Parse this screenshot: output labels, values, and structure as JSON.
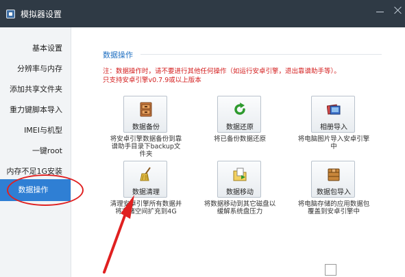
{
  "window": {
    "title": "模拟器设置"
  },
  "sidebar": {
    "items": [
      {
        "label": "基本设置"
      },
      {
        "label": "分辨率与内存"
      },
      {
        "label": "添加共享文件夹"
      },
      {
        "label": "重力键脚本导入"
      },
      {
        "label": "IMEI与机型"
      },
      {
        "label": "一键root"
      },
      {
        "label": "内存不足1G安装"
      },
      {
        "label": "数据操作"
      }
    ],
    "active_index": 7
  },
  "section": {
    "title": "数据操作",
    "notice_line1": "注：数据操作时，请不要进行其他任何操作（如运行安卓引擎，退出靠谱助手等）。",
    "notice_line2": "只支持安卓引擎v0.7.9或以上版本"
  },
  "tiles": [
    {
      "label": "数据备份",
      "desc": "将安卓引擎数据备份到靠谱助手目录下backup文件夹",
      "icon": "cabinet-icon"
    },
    {
      "label": "数据还原",
      "desc": "将已备份数据还原",
      "icon": "refresh-icon"
    },
    {
      "label": "相册导入",
      "desc": "将电脑图片导入安卓引擎中",
      "icon": "photo-album-icon"
    },
    {
      "label": "数据清理",
      "desc": "清理安卓引擎所有数据并将存储空间扩充到4G",
      "icon": "broom-icon"
    },
    {
      "label": "数据移动",
      "desc": "将数据移动到其它磁盘以缓解系统盘压力",
      "icon": "folder-move-icon"
    },
    {
      "label": "数据包导入",
      "desc": "将电脑存储的应用数据包覆盖到安卓引擎中",
      "icon": "package-icon"
    }
  ],
  "colors": {
    "titlebar": "#2f3a45",
    "accent": "#2f7fd4",
    "warning": "#d42020",
    "annotation": "#e02020"
  }
}
